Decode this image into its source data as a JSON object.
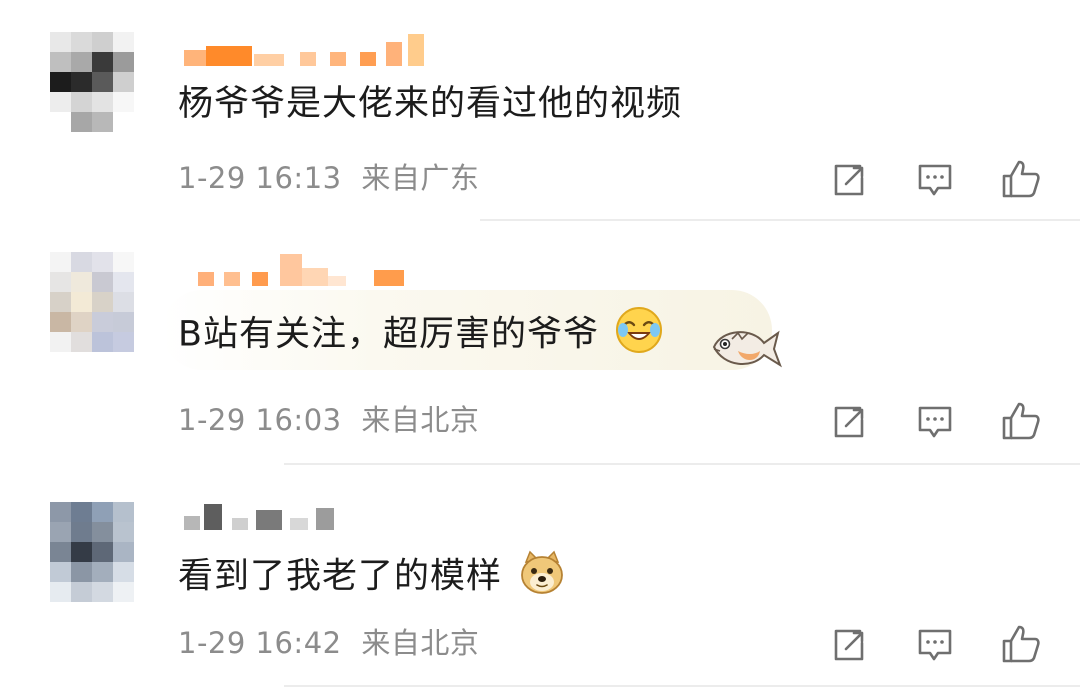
{
  "comments": [
    {
      "text": "杨爷爷是大佬来的看过他的视频",
      "time": "1-29 16:13",
      "location": "来自广东",
      "emoji": ""
    },
    {
      "text": "B站有关注，超厉害的爷爷",
      "time": "1-29 16:03",
      "location": "来自北京",
      "emoji": "laughing-crying-emoji"
    },
    {
      "text": "看到了我老了的模样",
      "time": "1-29 16:42",
      "location": "来自北京",
      "emoji": "doge-emoji"
    }
  ],
  "actions": {
    "icons": [
      "share-icon",
      "reply-icon",
      "like-icon"
    ]
  },
  "colors": {
    "text": "#1c1c1c",
    "meta": "#8c8c8c",
    "icon": "#6f6f6f",
    "username_orange": "#ff8200",
    "divider": "#ececec"
  }
}
